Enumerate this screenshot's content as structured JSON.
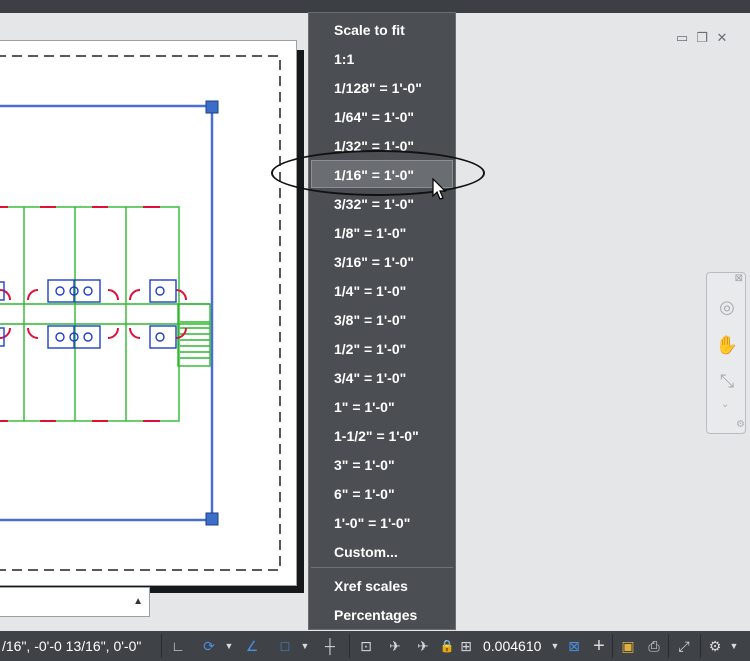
{
  "scale_menu": {
    "items": [
      {
        "label": "Scale to fit"
      },
      {
        "label": "1:1"
      },
      {
        "label": "1/128\" = 1'-0\""
      },
      {
        "label": "1/64\" = 1'-0\""
      },
      {
        "label": "1/32\" = 1'-0\""
      },
      {
        "label": "1/16\" = 1'-0\"",
        "highlighted": true
      },
      {
        "label": "3/32\" = 1'-0\""
      },
      {
        "label": "1/8\" = 1'-0\""
      },
      {
        "label": "3/16\" = 1'-0\""
      },
      {
        "label": "1/4\" = 1'-0\""
      },
      {
        "label": "3/8\" = 1'-0\""
      },
      {
        "label": "1/2\" = 1'-0\""
      },
      {
        "label": "3/4\" = 1'-0\""
      },
      {
        "label": "1\" = 1'-0\""
      },
      {
        "label": "1-1/2\" = 1'-0\""
      },
      {
        "label": "3\" = 1'-0\""
      },
      {
        "label": "6\" = 1'-0\""
      },
      {
        "label": "1'-0\" = 1'-0\""
      },
      {
        "label": "Custom..."
      }
    ],
    "footer_items": [
      {
        "label": "Xref scales"
      },
      {
        "label": "Percentages"
      }
    ]
  },
  "status_bar": {
    "coordinates": "/16\", -0'-0 13/16\", 0'-0\"",
    "scale_value": "0.004610"
  },
  "window_controls": {
    "icons": [
      "minimize-icon",
      "restore-icon",
      "close-icon"
    ]
  },
  "colors": {
    "menu_bg": "#4b4e52",
    "menu_highlight": "#6a6d72",
    "status_bg": "#3f4246",
    "viewport_border": "#4a6fd1",
    "walls": "#2eb82e",
    "doors": "#e0103a",
    "fixtures": "#1f3fd0"
  }
}
